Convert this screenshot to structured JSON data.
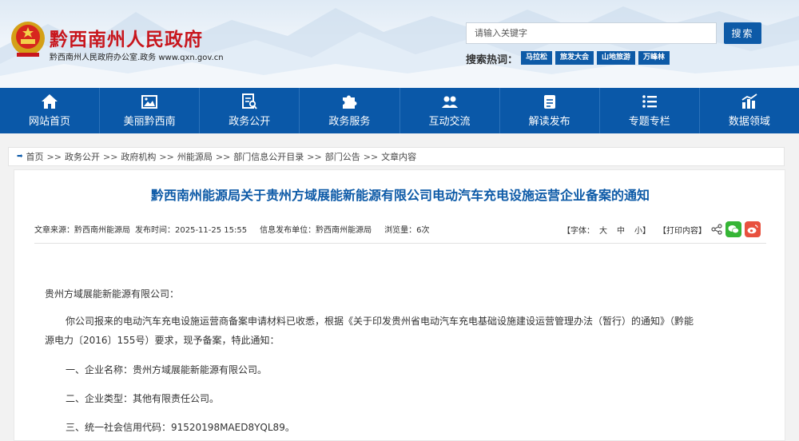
{
  "header": {
    "site_title": "黔西南州人民政府",
    "site_sub": "黔西南州人民政府办公室.政务  www.qxn.gov.cn",
    "search_placeholder": "请输入关键字",
    "search_button": "搜索",
    "hot_label": "搜索热词：",
    "hot_tags": [
      "马拉松",
      "旅发大会",
      "山地旅游",
      "万峰林"
    ]
  },
  "nav": [
    {
      "label": "网站首页",
      "icon": "home-icon"
    },
    {
      "label": "美丽黔西南",
      "icon": "photo-icon"
    },
    {
      "label": "政务公开",
      "icon": "document-search-icon"
    },
    {
      "label": "政务服务",
      "icon": "puzzle-icon"
    },
    {
      "label": "互动交流",
      "icon": "people-icon"
    },
    {
      "label": "解读发布",
      "icon": "clipboard-icon"
    },
    {
      "label": "专题专栏",
      "icon": "list-icon"
    },
    {
      "label": "数据领域",
      "icon": "chart-icon"
    }
  ],
  "breadcrumb": [
    "首页",
    "政务公开",
    "政府机构",
    "州能源局",
    "部门信息公开目录",
    "部门公告",
    "文章内容"
  ],
  "article": {
    "title": "黔西南州能源局关于贵州方域展能新能源有限公司电动汽车充电设施运营企业备案的通知",
    "meta": {
      "source": "文章来源：黔西南州能源局",
      "time": "发布时间：2025-11-25 15:55",
      "unit": "信息发布单位：黔西南州能源局",
      "views": "浏览量：6次"
    },
    "tools": {
      "font_label": "【字体：",
      "large": "大",
      "medium": "中",
      "small": "小】",
      "print": "【打印内容】"
    },
    "paragraphs": [
      "贵州方域展能新能源有限公司：",
      "你公司报来的电动汽车充电设施运营商备案申请材料已收悉，根据《关于印发贵州省电动汽车充电基础设施建设运营管理办法（暂行）的通知》（黔能",
      "源电力〔2016〕155号）要求，现予备案，特此通知：",
      "一、企业名称：贵州方域展能新能源有限公司。",
      "二、企业类型：其他有限责任公司。",
      "三、统一社会信用代码：91520198MAED8YQL89。"
    ]
  },
  "colors": {
    "primary_blue": "#0a58a8",
    "title_red": "#c8161d",
    "title_blue": "#0d5aa7"
  }
}
